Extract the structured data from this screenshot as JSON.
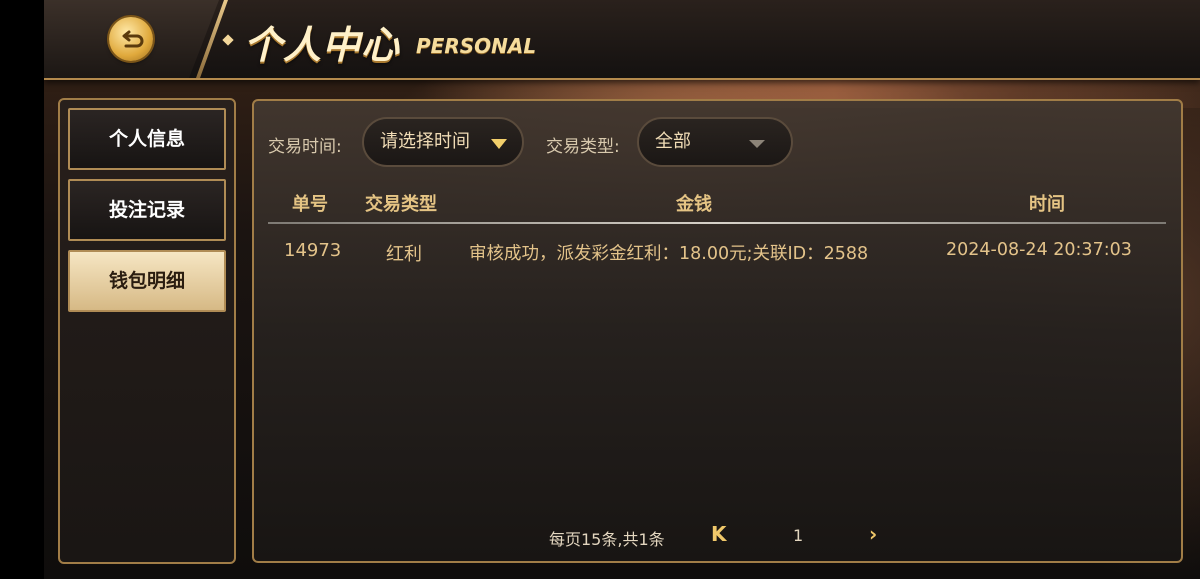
{
  "header": {
    "title_cn": "个人中心",
    "title_en": "PERSONAL",
    "back_icon": "back-arrow-icon"
  },
  "sidebar": {
    "items": [
      {
        "label": "个人信息",
        "active": false
      },
      {
        "label": "投注记录",
        "active": false
      },
      {
        "label": "钱包明细",
        "active": true
      }
    ]
  },
  "filters": {
    "time_label": "交易时间:",
    "time_value": "请选择时间",
    "type_label": "交易类型:",
    "type_value": "全部"
  },
  "table": {
    "headers": [
      "单号",
      "交易类型",
      "金钱",
      "时间"
    ],
    "rows": [
      {
        "id": "14973",
        "type": "红利",
        "amount": "审核成功，派发彩金红利：18.00元;关联ID：2588",
        "time": "2024-08-24 20:37:03"
      }
    ]
  },
  "pagination": {
    "summary": "每页15条,共1条",
    "prev_icon": "chevron-left-icon",
    "page": "1",
    "next_icon": "chevron-right-icon"
  },
  "colors": {
    "accent_gold": "#e5c484",
    "border_gold": "#a17d47",
    "active_tab": "#f6e6c3"
  }
}
